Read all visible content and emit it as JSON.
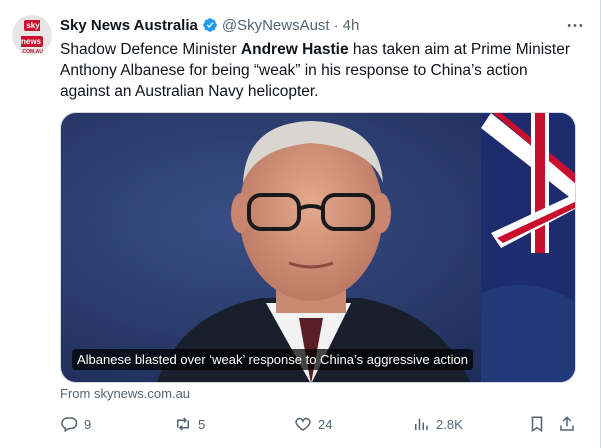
{
  "author": {
    "name": "Sky News Australia",
    "handle": "@SkyNewsAust",
    "separator": "·",
    "time": "4h",
    "avatar_logo": "sky news",
    "avatar_sub": ".COM.AU"
  },
  "tweet": {
    "text_before": "Shadow Defence Minister ",
    "text_bold": "Andrew Hastie",
    "text_after": " has taken aim at Prime Minister Anthony Albanese for being “weak” in his response to China’s action against an Australian Navy helicopter."
  },
  "media": {
    "caption": "Albanese blasted over ‘weak’ response to China’s aggressive action"
  },
  "source": "From skynews.com.au",
  "actions": {
    "replies": "9",
    "reposts": "5",
    "likes": "24",
    "views": "2.8K"
  },
  "icons": {
    "verified": "verified-badge-icon",
    "more": "more-options-icon",
    "reply": "reply-icon",
    "repost": "repost-icon",
    "like": "heart-icon",
    "views": "views-chart-icon",
    "bookmark": "bookmark-icon",
    "share": "share-icon"
  },
  "colors": {
    "text": "#0f1419",
    "secondary": "#536471",
    "verified": "#1d9bf0",
    "border": "#cfd9de"
  }
}
